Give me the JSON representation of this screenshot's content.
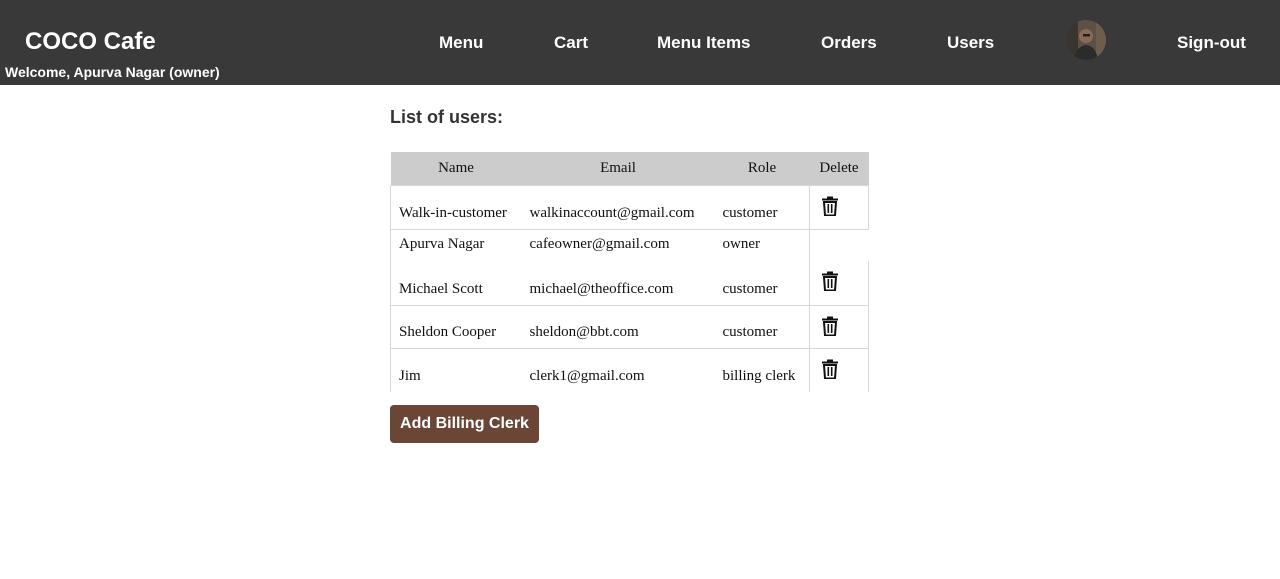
{
  "header": {
    "brand": "COCO Cafe",
    "welcome": "Welcome, Apurva Nagar (owner)",
    "nav": {
      "menu": "Menu",
      "cart": "Cart",
      "menu_items": "Menu Items",
      "orders": "Orders",
      "users": "Users",
      "signout": "Sign-out"
    }
  },
  "main": {
    "title": "List of users:",
    "columns": [
      "Name",
      "Email",
      "Role",
      "Delete"
    ],
    "users": [
      {
        "name": "Walk-in-customer",
        "email": "walkinaccount@gmail.com",
        "role": "customer",
        "deletable": true
      },
      {
        "name": "Apurva Nagar",
        "email": "cafeowner@gmail.com",
        "role": "owner",
        "deletable": false
      },
      {
        "name": "Michael Scott",
        "email": "michael@theoffice.com",
        "role": "customer",
        "deletable": true
      },
      {
        "name": "Sheldon Cooper",
        "email": "sheldon@bbt.com",
        "role": "customer",
        "deletable": true
      },
      {
        "name": "Jim",
        "email": "clerk1@gmail.com",
        "role": "billing clerk",
        "deletable": true
      }
    ],
    "add_button": "Add Billing Clerk"
  },
  "colors": {
    "navbar_bg": "#3a3939",
    "button_bg": "#6b4636",
    "table_header_bg": "#cccccc"
  }
}
